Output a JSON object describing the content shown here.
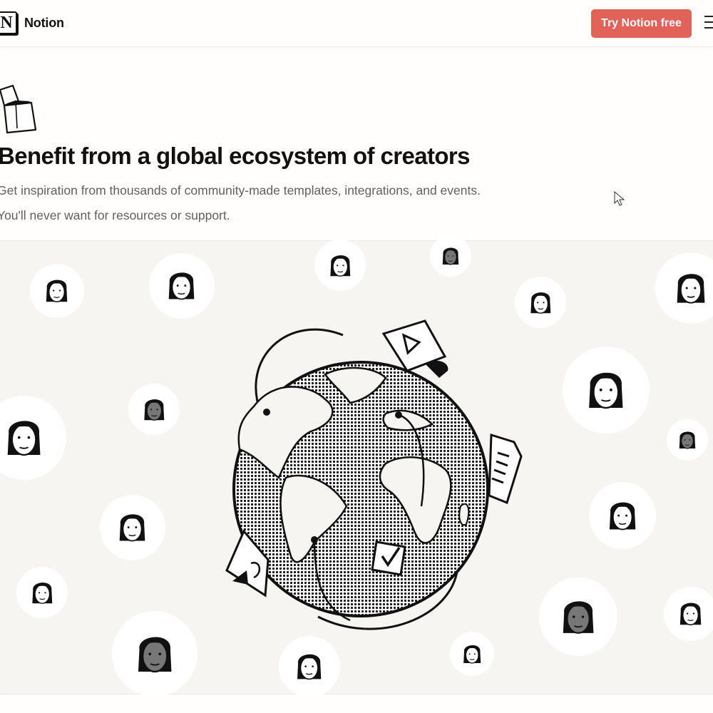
{
  "header": {
    "brand": "Notion",
    "logo_glyph": "N",
    "cta_label": "Try Notion free",
    "menu_icon": "hamburger-menu-icon"
  },
  "hero": {
    "icon": "open-box-icon",
    "title": "Benefit from a global ecosystem of creators",
    "subtitle_line1": "Get inspiration from thousands of community-made templates, integrations, and events.",
    "subtitle_line2": "You'll never want for resources or support."
  },
  "illustration": {
    "center": "globe-illustration",
    "orbit_items": [
      "play-card-icon",
      "document-card-icon",
      "checkbox-card-icon",
      "shape-card-icon"
    ],
    "avatars": [
      {
        "name": "avatar-woman-bob",
        "shade": "light"
      },
      {
        "name": "avatar-woman-long-hair",
        "shade": "light"
      },
      {
        "name": "avatar-man-short-hair",
        "shade": "light"
      },
      {
        "name": "avatar-man-bald-top",
        "shade": "gray"
      },
      {
        "name": "avatar-woman-bangs",
        "shade": "light"
      },
      {
        "name": "avatar-man-beard",
        "shade": "light"
      },
      {
        "name": "avatar-man-quiff",
        "shade": "light"
      },
      {
        "name": "avatar-man-gray",
        "shade": "gray"
      },
      {
        "name": "avatar-woman-large",
        "shade": "light"
      },
      {
        "name": "avatar-woman-gray-small",
        "shade": "gray"
      },
      {
        "name": "avatar-woman-straight",
        "shade": "light"
      },
      {
        "name": "avatar-woman-bob-right",
        "shade": "light"
      },
      {
        "name": "avatar-man-glasses",
        "shade": "light"
      },
      {
        "name": "avatar-man-bald",
        "shade": "gray"
      },
      {
        "name": "avatar-man-young",
        "shade": "light"
      },
      {
        "name": "avatar-woman-glasses",
        "shade": "light"
      },
      {
        "name": "avatar-woman-gray-long",
        "shade": "gray"
      },
      {
        "name": "avatar-man-curly",
        "shade": "light"
      }
    ]
  },
  "colors": {
    "accent": "#e16259",
    "panel_bg": "#f7f5f2",
    "page_bg": "#fffefc",
    "subtitle_text": "#615f5b"
  }
}
